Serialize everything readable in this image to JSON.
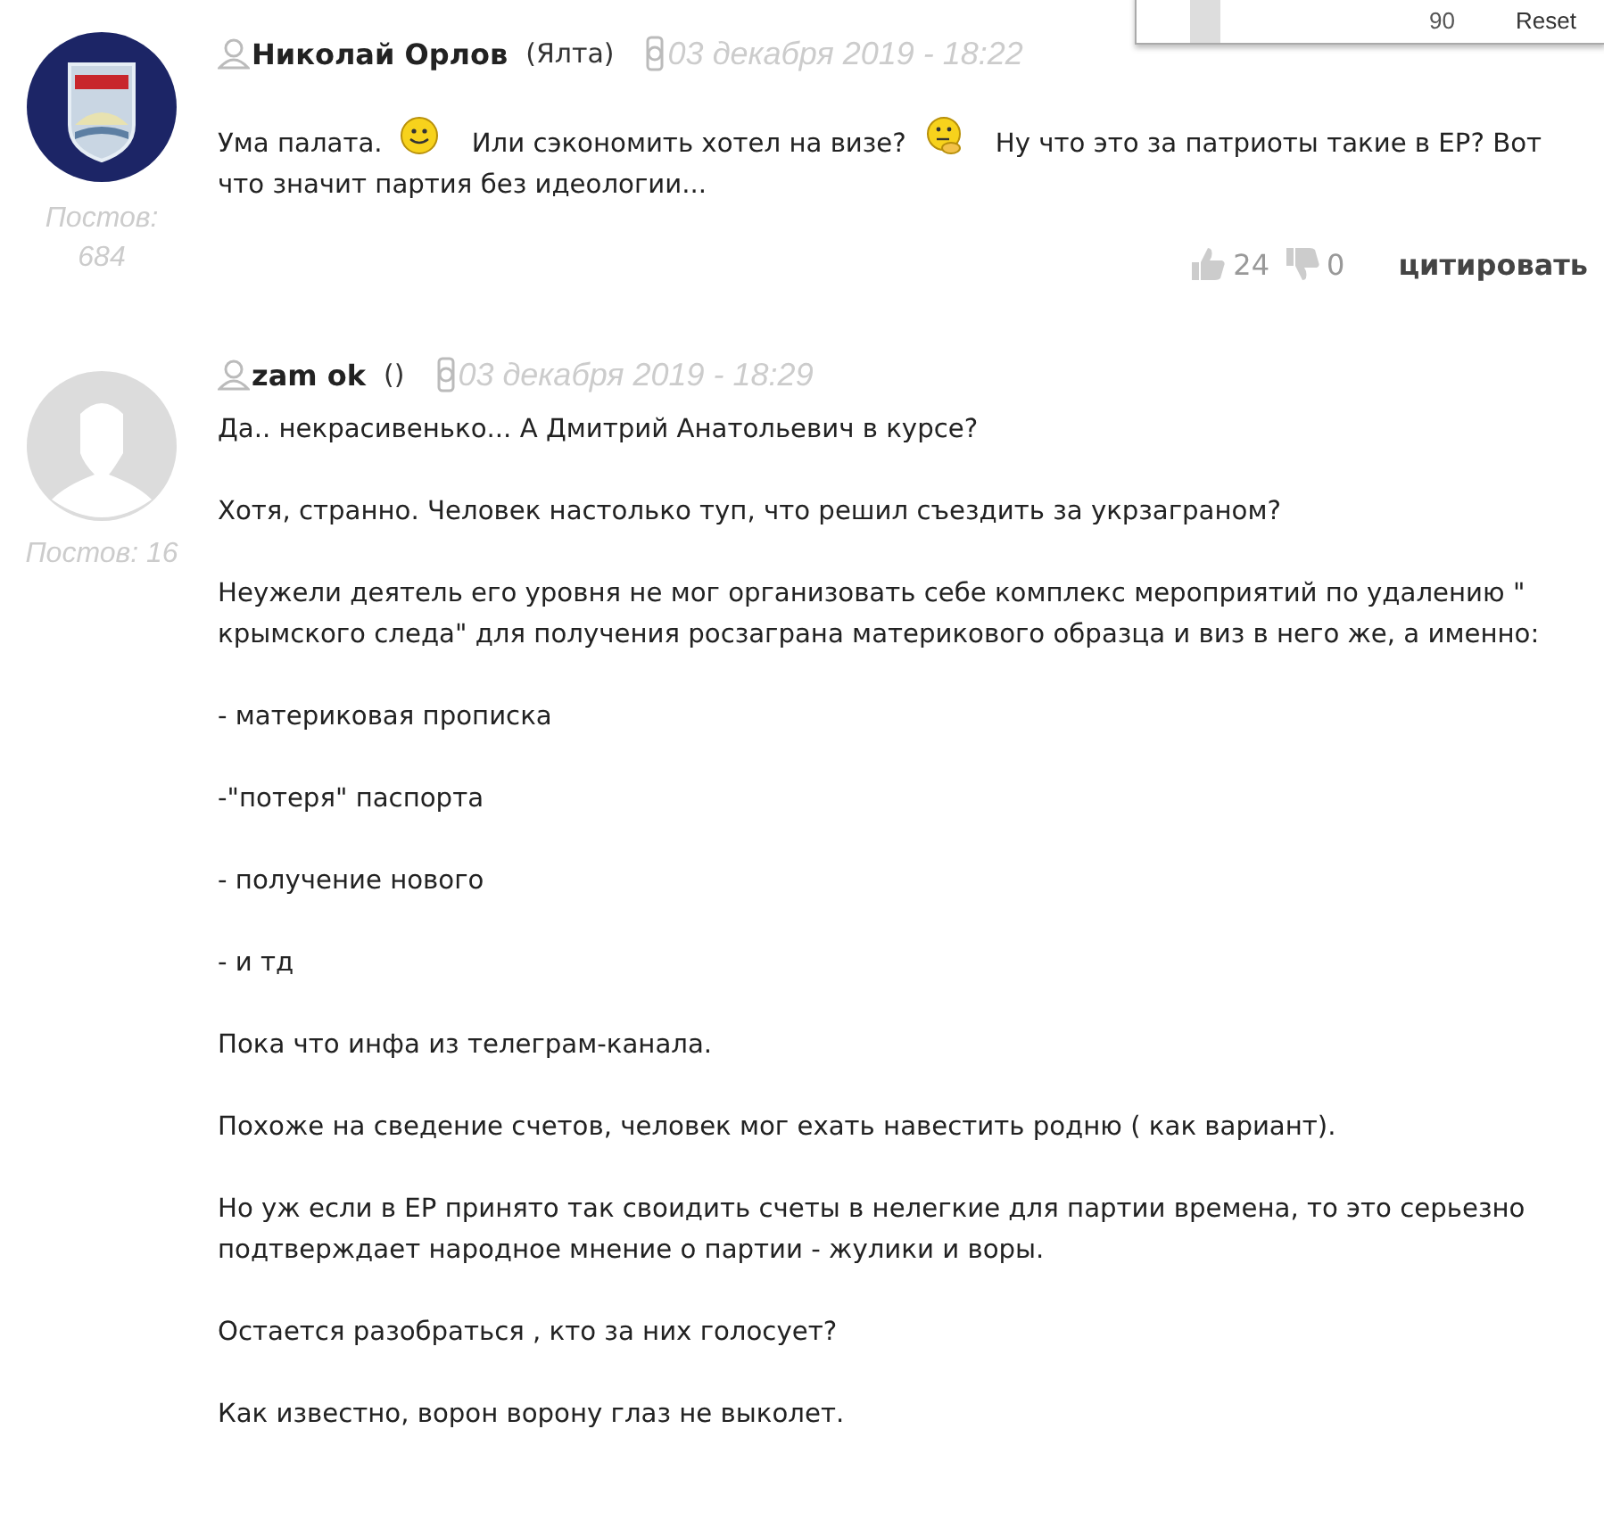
{
  "popup": {
    "value": "90",
    "action": "Reset"
  },
  "posts": [
    {
      "avatar": {
        "kind": "emblem"
      },
      "author": "Николай Орлов",
      "city": "(Ялта)",
      "date": "03 декабря 2019 - 18:22",
      "count_lines": [
        "Постов:",
        "684"
      ],
      "paragraphs": [
        [
          {
            "kind": "text",
            "text": "Ума палата."
          },
          {
            "kind": "smile"
          },
          {
            "kind": "text",
            "text": "Или сэкономить хотел на визе?"
          },
          {
            "kind": "thinking"
          },
          {
            "kind": "text",
            "text": "Ну что это за патриоты такие в ЕР? Вот что значит партия без идеологии..."
          }
        ]
      ],
      "actions": {
        "likes": "24",
        "dislikes": "0",
        "quote": "цитировать"
      }
    },
    {
      "avatar": {
        "kind": "silhouette"
      },
      "author": "zam ok",
      "city": "()",
      "date": "03 декабря 2019 - 18:29",
      "count_lines": [
        "Постов: 16"
      ],
      "paragraphs": [
        [
          {
            "kind": "text",
            "text": "Да.. некрасивенько... А Дмитрий Анатольевич в курсе?"
          }
        ],
        [
          {
            "kind": "text",
            "text": "Хотя, странно. Человек настолько туп, что решил съездить за укрзаграном?"
          }
        ],
        [
          {
            "kind": "text",
            "text": "Неужели деятель его уровня не мог организовать себе комплекс мероприятий по удалению \" крымского следа\" для получения росзаграна материкового образца и виз в него же, а именно:"
          }
        ],
        [
          {
            "kind": "text",
            "text": "- материковая прописка"
          }
        ],
        [
          {
            "kind": "text",
            "text": "-\"потеря\" паспорта"
          }
        ],
        [
          {
            "kind": "text",
            "text": "- получение нового"
          }
        ],
        [
          {
            "kind": "text",
            "text": "- и тд"
          }
        ],
        [
          {
            "kind": "text",
            "text": "Пока что инфа из телеграм-канала."
          }
        ],
        [
          {
            "kind": "text",
            "text": "Похоже на сведение счетов, человек мог ехать навестить родню ( как вариант)."
          }
        ],
        [
          {
            "kind": "text",
            "text": "Но уж если в ЕР принято так своидить счеты в нелегкие для партии времена, то это серьезно подтверждает народное мнение о партии - жулики и воры."
          }
        ],
        [
          {
            "kind": "text",
            "text": "Остается разобраться , кто за них голосует?"
          }
        ],
        [
          {
            "kind": "text",
            "text": "Как известно, ворон ворону глаз не выколет."
          }
        ]
      ]
    }
  ]
}
